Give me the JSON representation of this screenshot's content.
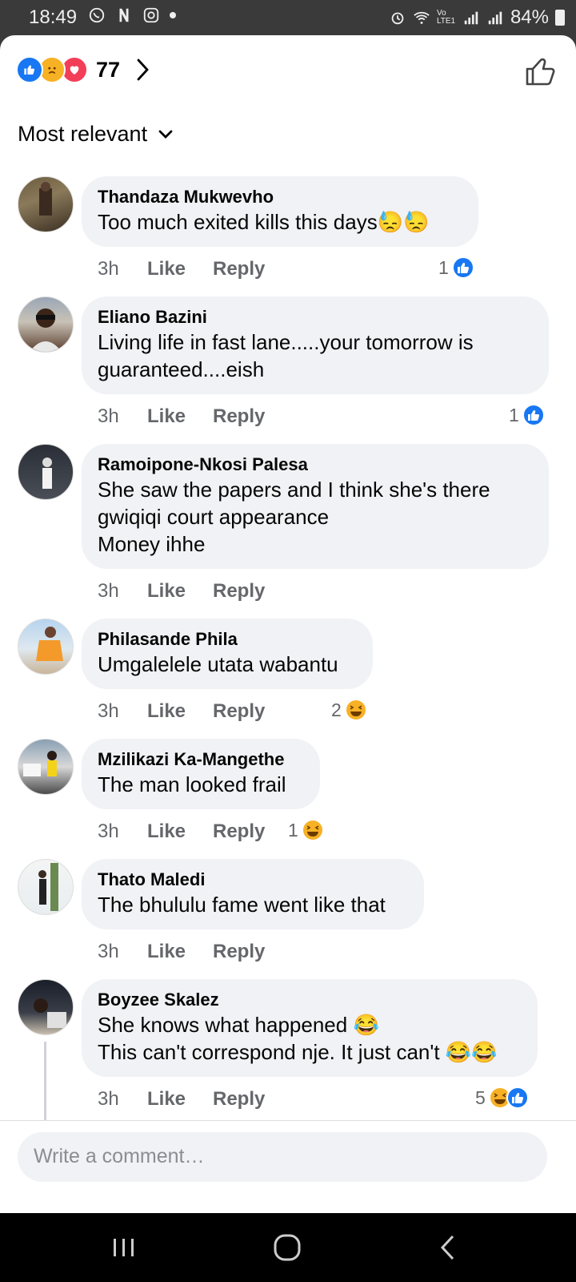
{
  "status": {
    "time": "18:49",
    "battery": "84%",
    "network": "Vo LTE1"
  },
  "reactions": {
    "types": [
      "like-icon",
      "sad-icon",
      "love-icon"
    ],
    "count": "77"
  },
  "sort": {
    "label": "Most relevant"
  },
  "comments": [
    {
      "author": "Thandaza Mukwevho",
      "text": "Too much exited  kills this days",
      "emoji_suffix": "😓😓",
      "time": "3h",
      "like": "Like",
      "reply": "Reply",
      "reaction_count": "1",
      "reaction_types": [
        "like"
      ]
    },
    {
      "author": "Eliano Bazini",
      "text": "Living life in fast lane.....your tomorrow is\nguaranteed....eish",
      "emoji_suffix": "",
      "time": "3h",
      "like": "Like",
      "reply": "Reply",
      "reaction_count": "1",
      "reaction_types": [
        "like"
      ]
    },
    {
      "author": "Ramoipone-Nkosi Palesa",
      "text": "She saw the papers and I think she's there\ngwiqiqi court appearance\nMoney ihhe",
      "emoji_suffix": "",
      "time": "3h",
      "like": "Like",
      "reply": "Reply",
      "reaction_count": "",
      "reaction_types": []
    },
    {
      "author": "Philasande Phila",
      "text": "Umgalelele utata wabantu",
      "emoji_suffix": "",
      "time": "3h",
      "like": "Like",
      "reply": "Reply",
      "reaction_count": "2",
      "reaction_types": [
        "haha"
      ]
    },
    {
      "author": "Mzilikazi Ka-Mangethe",
      "text": "The man looked frail",
      "emoji_suffix": "",
      "time": "3h",
      "like": "Like",
      "reply": "Reply",
      "reaction_count": "1",
      "reaction_types": [
        "haha"
      ]
    },
    {
      "author": "Thato Maledi",
      "text": "The bhululu fame went like that",
      "emoji_suffix": "",
      "time": "3h",
      "like": "Like",
      "reply": "Reply",
      "reaction_count": "",
      "reaction_types": []
    },
    {
      "author": "Boyzee Skalez",
      "text": "She knows what happened 😂\nThis can't correspond nje. It just can't 😂😂",
      "emoji_suffix": "",
      "time": "3h",
      "like": "Like",
      "reply": "Reply",
      "reaction_count": "5",
      "reaction_types": [
        "haha",
        "like"
      ]
    }
  ],
  "composer": {
    "placeholder": "Write a comment…"
  },
  "colors": {
    "accent": "#1877f2",
    "bubble": "#f0f2f5",
    "muted": "#65676b"
  }
}
